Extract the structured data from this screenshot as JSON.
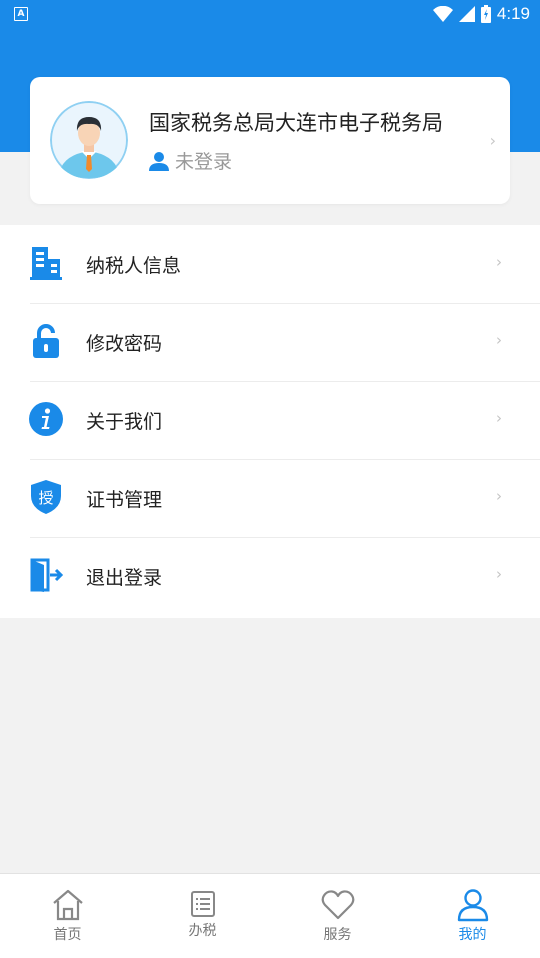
{
  "status_bar": {
    "notification": "A",
    "time": "4:19"
  },
  "profile": {
    "org_name": "国家税务总局大连市电子税务局",
    "login_status": "未登录"
  },
  "menu": {
    "items": [
      {
        "label": "纳税人信息",
        "icon": "building-icon"
      },
      {
        "label": "修改密码",
        "icon": "lock-icon"
      },
      {
        "label": "关于我们",
        "icon": "info-icon"
      },
      {
        "label": "证书管理",
        "icon": "certificate-shield-icon"
      },
      {
        "label": "退出登录",
        "icon": "logout-door-icon"
      }
    ]
  },
  "cert_icon_char": "授",
  "tabbar": {
    "tabs": [
      {
        "label": "首页",
        "icon": "home-icon"
      },
      {
        "label": "办税",
        "icon": "list-icon"
      },
      {
        "label": "服务",
        "icon": "heart-icon"
      },
      {
        "label": "我的",
        "icon": "person-icon",
        "active": true
      }
    ]
  },
  "colors": {
    "primary": "#1a8ae8",
    "background": "#f2f2f2"
  }
}
